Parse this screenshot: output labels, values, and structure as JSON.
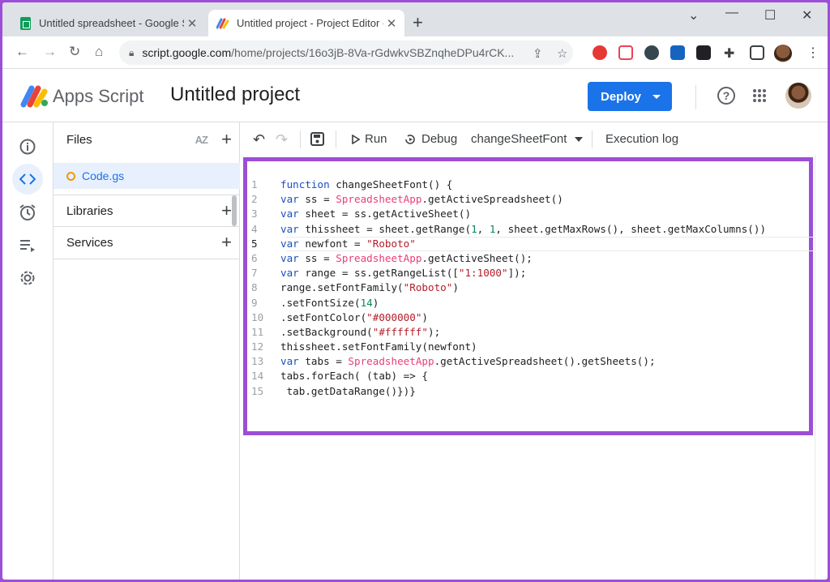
{
  "browser": {
    "tabs": [
      {
        "title": "Untitled spreadsheet - Google Sh",
        "active": false
      },
      {
        "title": "Untitled project - Project Editor -",
        "active": true
      }
    ],
    "url_main": "script.google.com",
    "url_path": "/home/projects/16o3jB-8Va-rGdwkvSBZnqheDPu4rCK..."
  },
  "header": {
    "brand": "Apps Script",
    "project_title": "Untitled project",
    "deploy_label": "Deploy"
  },
  "files_panel": {
    "files_label": "Files",
    "az_label": "AZ",
    "file_name": "Code.gs",
    "libraries_label": "Libraries",
    "services_label": "Services"
  },
  "editor_toolbar": {
    "run_label": "Run",
    "debug_label": "Debug",
    "function_name": "changeSheetFont",
    "execution_log_label": "Execution log"
  },
  "code": {
    "current_line": 5,
    "lines": [
      "function changeSheetFont() {",
      "var ss = SpreadsheetApp.getActiveSpreadsheet()",
      "var sheet = ss.getActiveSheet()",
      "var thissheet = sheet.getRange(1, 1, sheet.getMaxRows(), sheet.getMaxColumns())",
      "var newfont = \"Roboto\"",
      "var ss = SpreadsheetApp.getActiveSheet();",
      "var range = ss.getRangeList([\"1:1000\"]);",
      "range.setFontFamily(\"Roboto\")",
      ".setFontSize(14)",
      ".setFontColor(\"#000000\")",
      ".setBackground(\"#ffffff\");",
      "thissheet.setFontFamily(newfont)",
      "var tabs = SpreadsheetApp.getActiveSpreadsheet().getSheets();",
      "tabs.forEach( (tab) => {",
      " tab.getDataRange()})}"
    ]
  },
  "colors": {
    "accent": "#1a73e8",
    "highlight_border": "#9c4fd6"
  }
}
